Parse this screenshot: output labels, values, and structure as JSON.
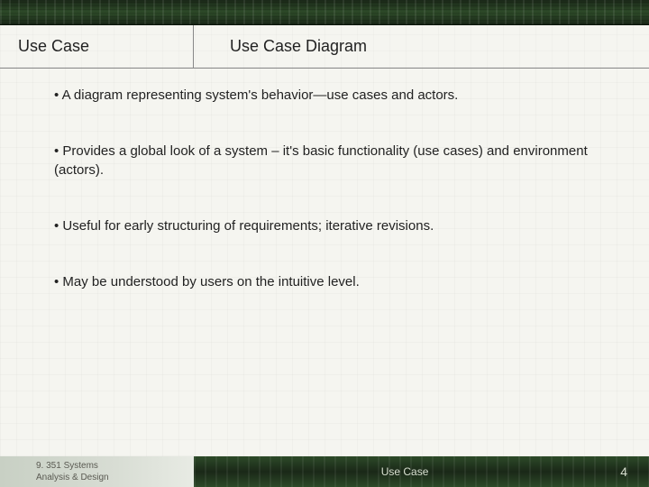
{
  "header": {
    "left": "Use Case",
    "title": "Use Case Diagram"
  },
  "bullets": [
    "• A diagram representing system's behavior—use cases and actors.",
    "• Provides a global look of a system – it's basic functionality (use cases) and environment (actors).",
    "• Useful for early structuring of requirements; iterative revisions.",
    "• May be understood by users on the intuitive level."
  ],
  "footer": {
    "course_line1": "9. 351    Systems",
    "course_line2": "Analysis & Design",
    "center": "Use Case",
    "page": "4"
  }
}
